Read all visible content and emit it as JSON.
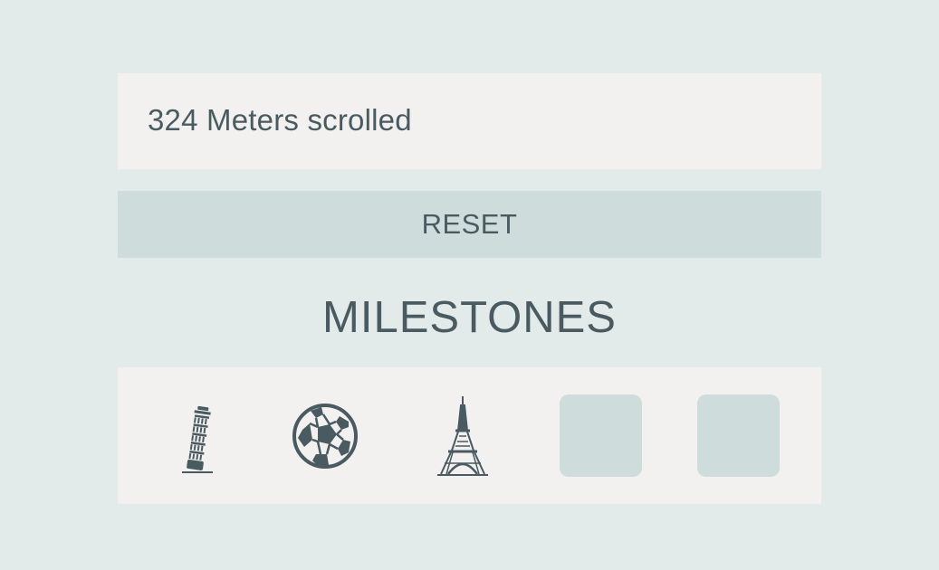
{
  "counter": {
    "text": "324 Meters scrolled"
  },
  "controls": {
    "reset_label": "RESET"
  },
  "milestones": {
    "title": "MILESTONES",
    "items": [
      {
        "icon": "leaning-tower-of-pisa-icon",
        "unlocked": true
      },
      {
        "icon": "soccer-ball-icon",
        "unlocked": true
      },
      {
        "icon": "eiffel-tower-icon",
        "unlocked": true
      },
      {
        "icon": "locked-placeholder",
        "unlocked": false
      },
      {
        "icon": "locked-placeholder",
        "unlocked": false
      }
    ]
  },
  "colors": {
    "background": "#e3eaea",
    "panel": "#f2f1ef",
    "accent": "#cfdcdc",
    "text": "#4a5a61",
    "icon": "#4a5a61"
  }
}
